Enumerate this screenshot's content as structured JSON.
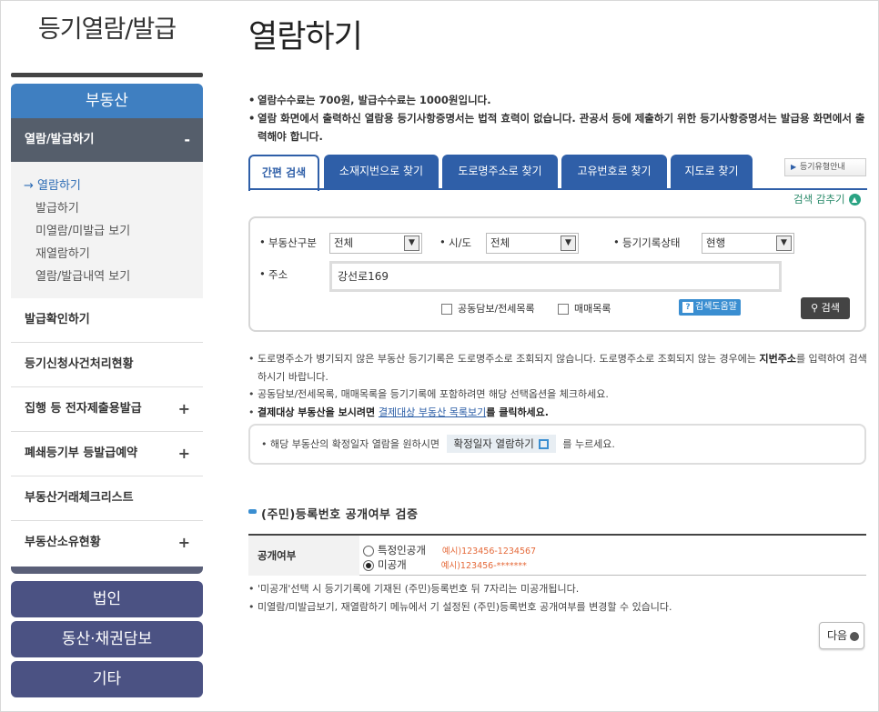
{
  "sidebar": {
    "title": "등기열람/발급",
    "category": "부동산",
    "selected": {
      "label": "열람/발급하기",
      "mark": "-"
    },
    "subitems": [
      {
        "label": "열람하기",
        "arrow": "→"
      },
      {
        "label": "발급하기"
      },
      {
        "label": "미열람/미발급 보기"
      },
      {
        "label": "재열람하기"
      },
      {
        "label": "열람/발급내역 보기"
      }
    ],
    "items": [
      {
        "label": "발급확인하기",
        "mark": ""
      },
      {
        "label": "등기신청사건처리현황",
        "mark": ""
      },
      {
        "label": "집행 등 전자제출용발급",
        "mark": "+"
      },
      {
        "label": "폐쇄등기부 등발급예약",
        "mark": "+"
      },
      {
        "label": "부동산거래체크리스트",
        "mark": ""
      },
      {
        "label": "부동산소유현황",
        "mark": "+"
      }
    ],
    "buttons": [
      "법인",
      "동산·채권담보",
      "기타"
    ]
  },
  "main": {
    "title": "열람하기",
    "notices": [
      "열람수수료는 700원, 발급수수료는 1000원입니다.",
      "열람 화면에서 출력하신 열람용 등기사항증명서는 법적 효력이 없습니다. 관공서 등에 제출하기 위한 등기사항증명서는 발급용 화면에서 출력해야 합니다."
    ],
    "tabs": [
      "간편 검색",
      "소재지번으로 찾기",
      "도로명주소로 찾기",
      "고유번호로 찾기",
      "지도로 찾기"
    ],
    "registry_info_button": "등기유형안내",
    "collapse_label": "검색 감추기",
    "form": {
      "type_label": "부동산구분",
      "type_value": "전체",
      "sido_label": "시/도",
      "sido_value": "전체",
      "status_label": "등기기록상태",
      "status_value": "현행",
      "address_label": "주소",
      "address_value": "강선로169",
      "check1": "공동담보/전세목록",
      "check2": "매매목록",
      "help_label": "검색도움말",
      "search_label": "검색"
    },
    "notes": {
      "n1a": "도로명주소가 병기되지 않은 부동산 등기기록은 도로명주소로 조회되지 않습니다. 도로명주소로 조회되지 않는 경우에는 ",
      "n1b": "지번주소",
      "n1c": "를 입력하여 검색하시기 바랍니다.",
      "n2": "공동담보/전세목록, 매매목록을 등기기록에 포함하려면 해당 선택옵션을 체크하세요.",
      "n3a": "결제대상 부동산을 보시려면 ",
      "n3link": "결제대상 부동산 목록보기",
      "n3b": "를 클릭하세요."
    },
    "confirm": {
      "pre": "해당 부동산의 확정일자 열람을 원하시면",
      "button": "확정일자 열람하기",
      "post": "를 누르세요."
    },
    "section_title": "(주민)등록번호 공개여부 검증",
    "table": {
      "header": "공개여부",
      "option1": "특정인공개",
      "example1": "예시)123456-1234567",
      "option2": "미공개",
      "example2": "예시)123456-*******",
      "selected": "미공개"
    },
    "notes2": [
      "'미공개'선택 시 등기기록에 기재된 (주민)등록번호 뒤 7자리는 미공개됩니다.",
      "미열람/미발급보기, 재열람하기 메뉴에서 기 설정된 (주민)등록번호 공개여부를 변경할 수 있습니다."
    ],
    "next_label": "다음"
  }
}
